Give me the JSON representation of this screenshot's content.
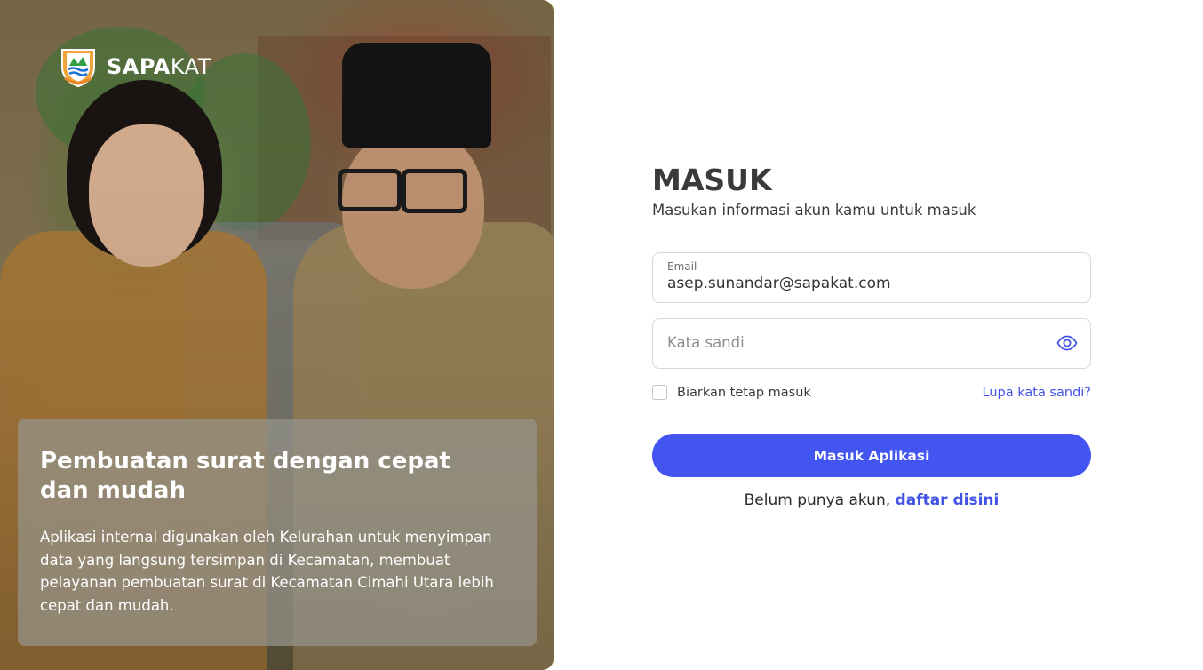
{
  "brand": {
    "name_bold": "SAPA",
    "name_light": "KAT",
    "logo_icon": "city-emblem-icon"
  },
  "hero": {
    "title": "Pembuatan surat dengan cepat dan mudah",
    "description": "Aplikasi internal digunakan oleh Kelurahan untuk menyimpan data yang langsung tersimpan di Kecamatan, membuat pelayanan pembuatan surat di Kecamatan Cimahi Utara lebih cepat dan mudah."
  },
  "login": {
    "title": "MASUK",
    "subtitle": "Masukan informasi akun kamu untuk masuk",
    "email": {
      "label": "Email",
      "value": "asep.sunandar@sapakat.com"
    },
    "password": {
      "placeholder": "Kata sandi",
      "toggle_icon": "eye-icon"
    },
    "remember_label": "Biarkan tetap masuk",
    "forgot_label": "Lupa kata sandi?",
    "submit_label": "Masuk Aplikasi",
    "signup_prefix": "Belum punya akun,",
    "signup_link": "daftar disini"
  },
  "colors": {
    "primary": "#4355f0",
    "link": "#4253e8",
    "text": "#3a3a3a",
    "border": "#d6d8dc"
  }
}
